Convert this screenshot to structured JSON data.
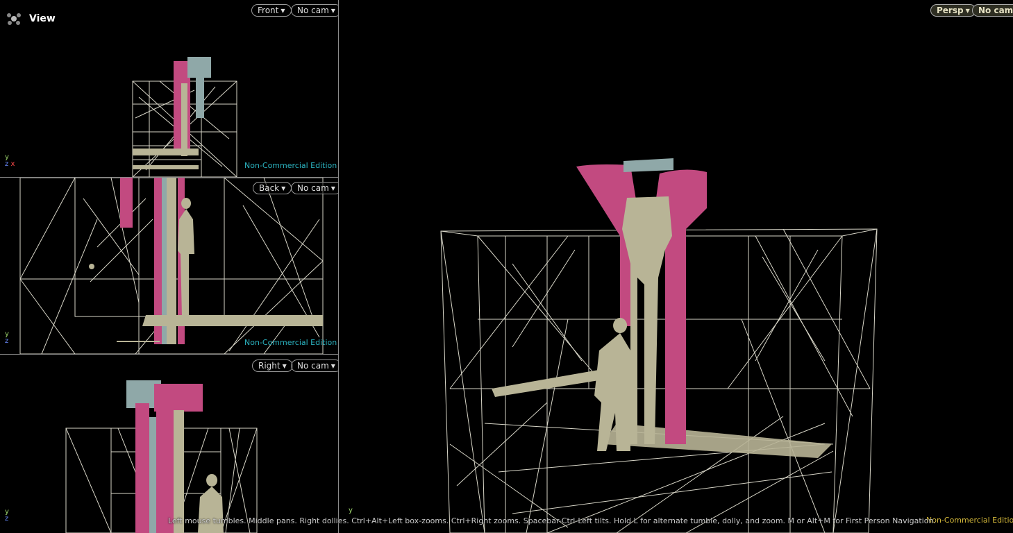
{
  "app": {
    "title": "View",
    "logo_icon": "houdini-logo-icon"
  },
  "viewports": {
    "front": {
      "view_label": "Front",
      "camera_label": "No cam",
      "edition": "Non-Commercial Edition",
      "axes": {
        "y": "y",
        "z": "z",
        "x": "x"
      }
    },
    "back": {
      "view_label": "Back",
      "camera_label": "No cam",
      "edition": "Non-Commercial Edition",
      "axes": {
        "y": "y",
        "z": "z"
      }
    },
    "right": {
      "view_label": "Right",
      "camera_label": "No cam",
      "axes": {
        "y": "y",
        "z": "z"
      }
    },
    "persp": {
      "view_label": "Persp",
      "camera_label": "No cam",
      "edition": "Non-Commercial Edition",
      "axes": {
        "y": "y"
      }
    }
  },
  "status": {
    "hint": "Left mouse tumbles. Middle pans. Right dollies. Ctrl+Alt+Left box-zooms. Ctrl+Right zooms. Spacebar-Ctrl-Left tilts. Hold L for alternate tumble, dolly, and zoom. M or Alt+M for First Person Navigation."
  },
  "colors": {
    "wire": "#d8d6c8",
    "pink": "#c24a80",
    "beige": "#b8b496",
    "teal": "#8fa8a8",
    "edition_teal": "#2bb3c0",
    "edition_yellow": "#d4b83a"
  }
}
